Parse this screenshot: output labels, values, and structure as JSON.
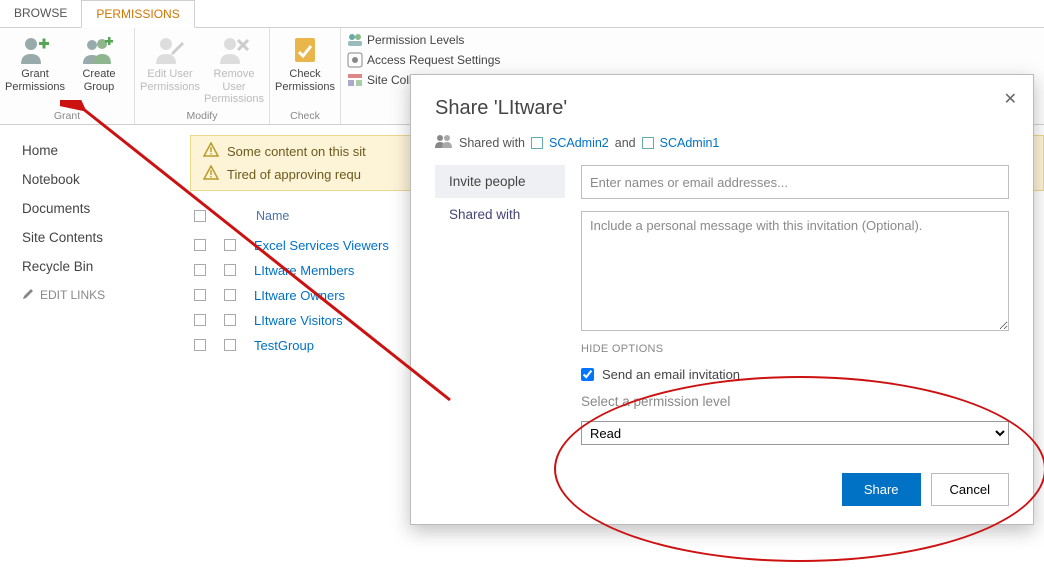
{
  "ribbon": {
    "tabs": {
      "browse": "BROWSE",
      "permissions": "PERMISSIONS"
    },
    "grant_group": {
      "grant_permissions": "Grant\nPermissions",
      "create_group": "Create\nGroup",
      "label": "Grant"
    },
    "modify_group": {
      "edit_user": "Edit User\nPermissions",
      "remove_user": "Remove User\nPermissions",
      "label": "Modify"
    },
    "check_group": {
      "check_permissions": "Check\nPermissions",
      "label": "Check"
    },
    "links": {
      "permission_levels": "Permission Levels",
      "access_request": "Access Request Settings",
      "site_coll": "Site Coll"
    }
  },
  "sidebar": {
    "items": [
      "Home",
      "Notebook",
      "Documents",
      "Site Contents",
      "Recycle Bin"
    ],
    "edit_links": "EDIT LINKS"
  },
  "messages": {
    "line1": "Some content on this sit",
    "line2": "Tired of approving requ"
  },
  "list": {
    "col_name": "Name",
    "rows": [
      "Excel Services Viewers",
      "LItware Members",
      "LItware Owners",
      "LItware Visitors",
      "TestGroup"
    ]
  },
  "dialog": {
    "title": "Share 'LItware'",
    "shared_label": "Shared with",
    "user1": "SCAdmin2",
    "and": " and ",
    "user2": "SCAdmin1",
    "tab_invite": "Invite people",
    "tab_shared": "Shared with",
    "names_placeholder": "Enter names or email addresses...",
    "msg_placeholder": "Include a personal message with this invitation (Optional).",
    "hide_options": "HIDE OPTIONS",
    "send_email": "Send an email invitation",
    "select_perm": "Select a permission level",
    "perm_value": "Read",
    "share": "Share",
    "cancel": "Cancel"
  }
}
